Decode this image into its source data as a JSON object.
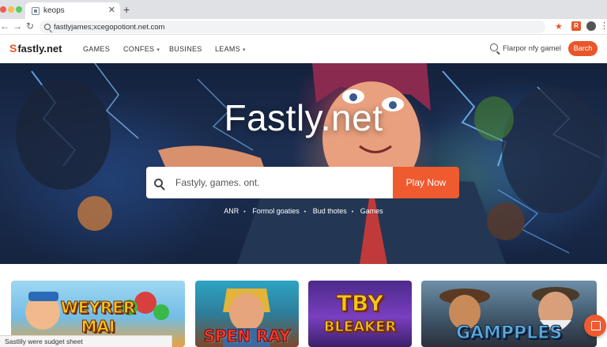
{
  "browser": {
    "tab_title": "keops",
    "tab_close": "✕",
    "new_tab": "+",
    "address": "fastlyjames;xcegopotiont.net.com",
    "back": "←",
    "forward": "→",
    "reload": "↻",
    "star_icon": "★",
    "ext_label": "R",
    "kebab": "⋮"
  },
  "site": {
    "logo_mark": "S",
    "logo_text": "fastly.net",
    "nav": [
      {
        "label": "GAMES"
      },
      {
        "label": "CONFES",
        "chevron": "▾"
      },
      {
        "label": "BUSINES"
      },
      {
        "label": "LEAMS",
        "chevron": "▾"
      }
    ],
    "search_label": "Flarpor nfy gamel",
    "cta_label": "Barch"
  },
  "hero": {
    "title": "Fastly.net",
    "search_placeholder": "Fastyly, games. ont.",
    "play_button": "Play Now",
    "tags": [
      "ANR",
      "Formol goaties",
      "Bud thotes",
      "Games"
    ],
    "separator": "•"
  },
  "cards": [
    {
      "title_line1": "WEYRER",
      "title_line2": "MAI"
    },
    {
      "title_line1": "SPEN RAY",
      "title_line2": ""
    },
    {
      "title_line1": "TBY",
      "title_line2": "BLEAKER"
    },
    {
      "title_line1": "GAMPPLES",
      "title_line2": ""
    }
  ],
  "status_text": "Sastlily were sudget sheet",
  "colors": {
    "accent": "#e8562a",
    "play": "#ef5a2f",
    "hero_dark": "#13213c"
  }
}
